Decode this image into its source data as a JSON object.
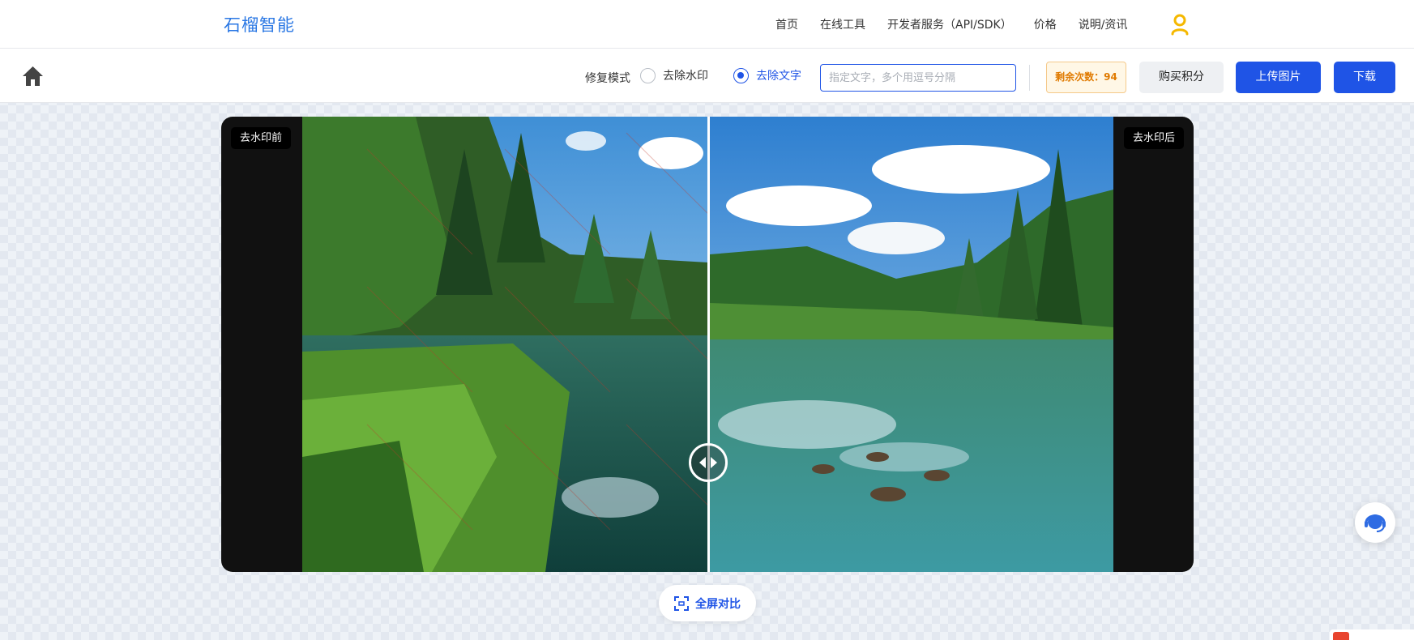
{
  "brand": {
    "name": "石榴智能"
  },
  "nav": {
    "items": [
      {
        "label": "首页"
      },
      {
        "label": "在线工具"
      },
      {
        "label": "开发者服务（API/SDK）"
      },
      {
        "label": "价格"
      },
      {
        "label": "说明/资讯"
      }
    ],
    "user_icon": "user-icon"
  },
  "toolbar": {
    "home_icon": "home-icon",
    "mode_label": "修复模式",
    "modes": [
      {
        "label": "去除水印",
        "selected": false
      },
      {
        "label": "去除文字",
        "selected": true
      }
    ],
    "text_input": {
      "placeholder": "指定文字，多个用逗号分隔",
      "value": ""
    },
    "credits_label": "剩余次数：94",
    "buy_label": "购买积分",
    "upload_label": "上传图片",
    "download_label": "下载"
  },
  "compare": {
    "before_label": "去水印前",
    "after_label": "去水印后",
    "slider_position": 0.5,
    "handle_icon": "compare-handle-icon"
  },
  "actions": {
    "fullscreen_label": "全屏对比",
    "fullscreen_icon": "fullscreen-icon",
    "support_icon": "customer-service-icon"
  },
  "colors": {
    "primary": "#1f54e6",
    "brand": "#2b78e4",
    "credits_text": "#e07a00",
    "credits_bg": "#fff7e6"
  }
}
